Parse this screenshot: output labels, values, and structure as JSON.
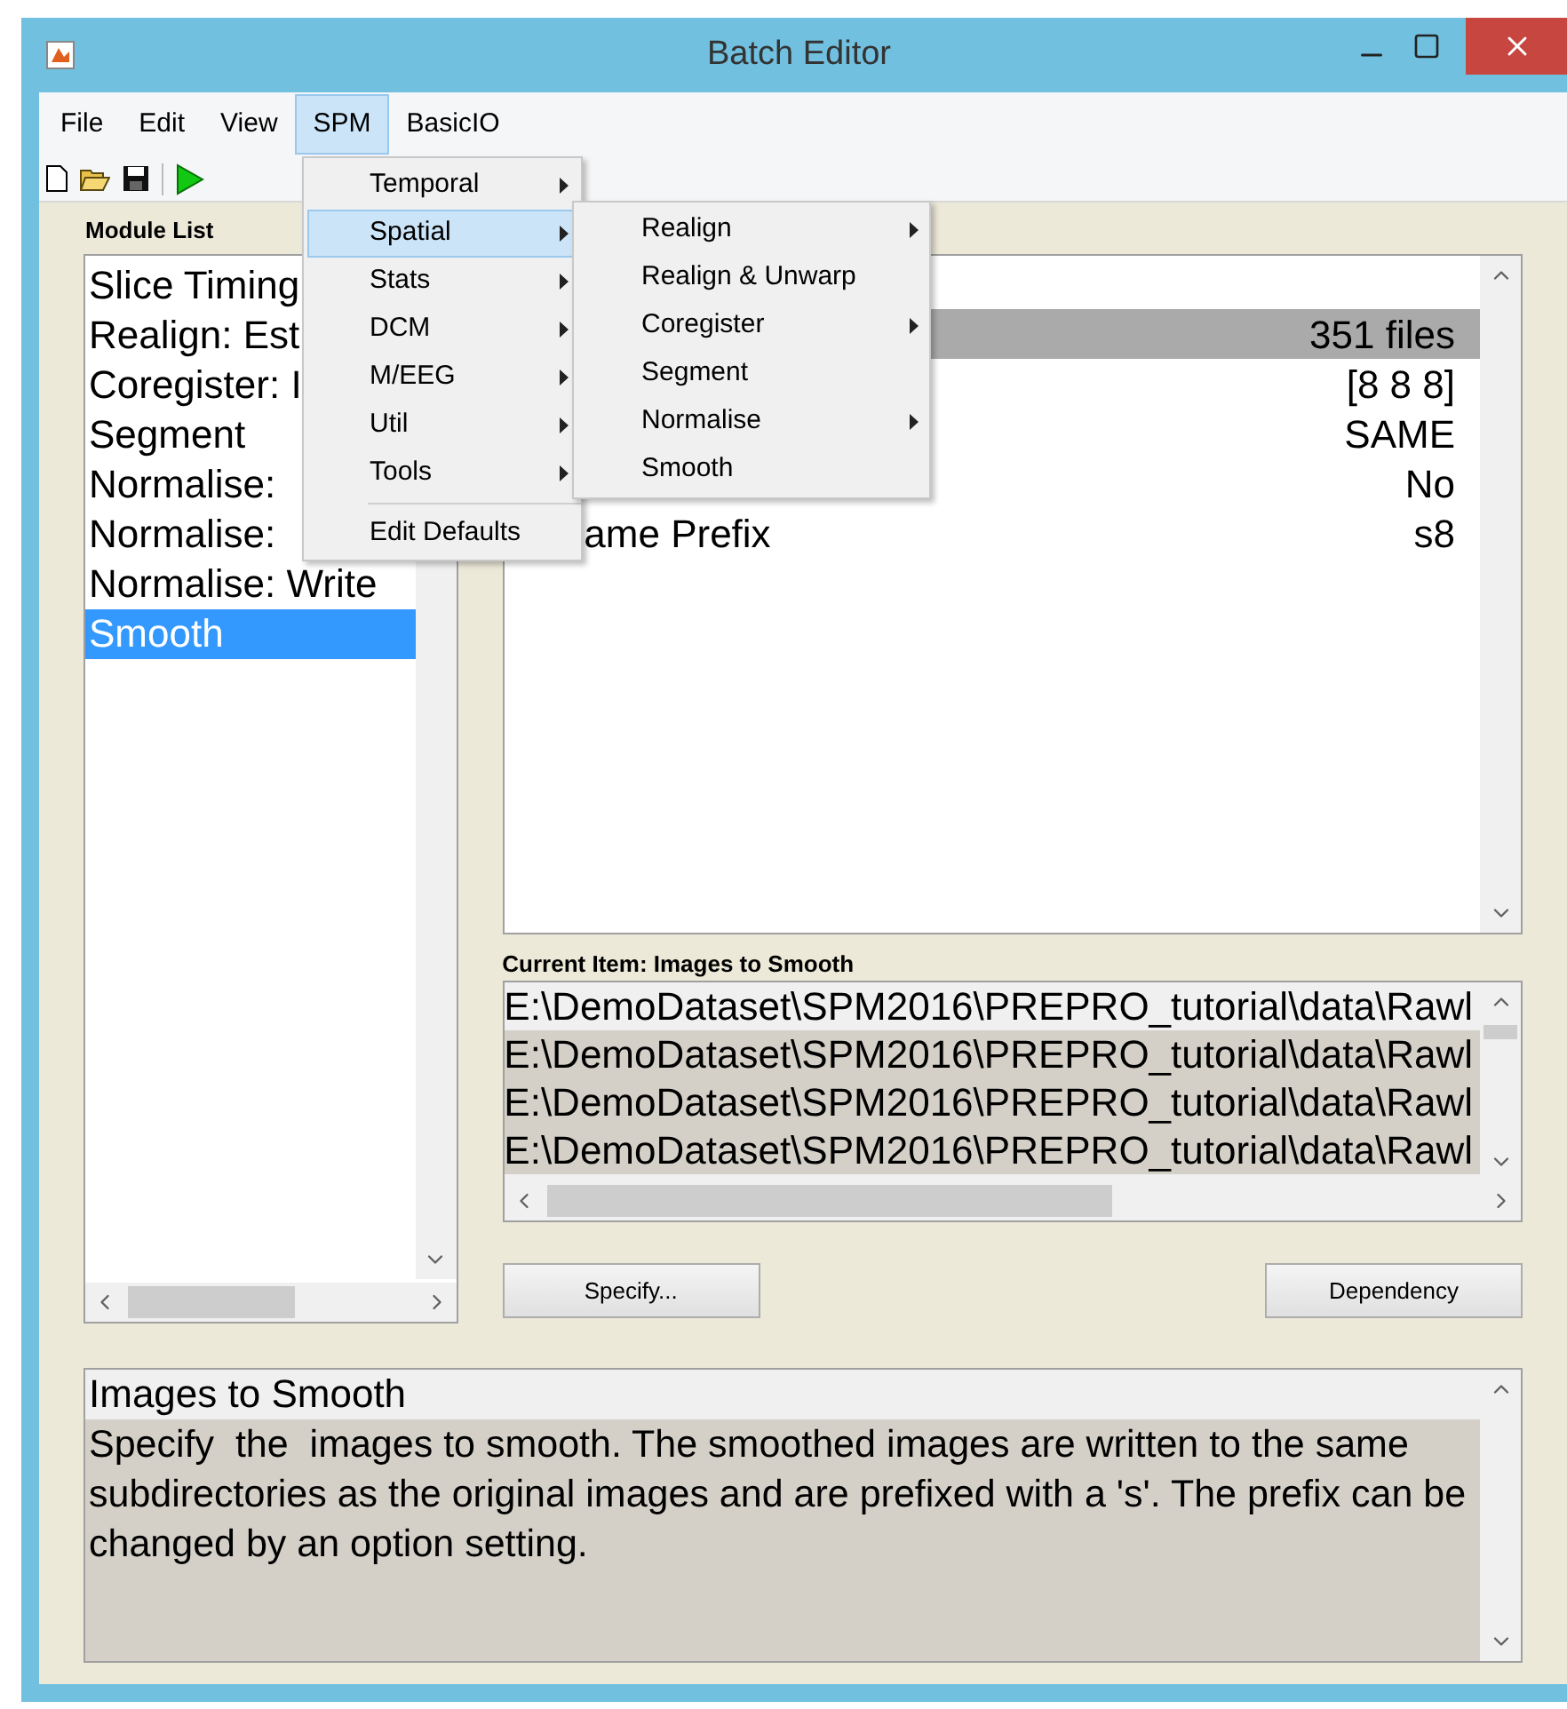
{
  "window": {
    "title": "Batch Editor"
  },
  "menu_bar": [
    {
      "label": "File",
      "selected": false
    },
    {
      "label": "Edit",
      "selected": false
    },
    {
      "label": "View",
      "selected": false
    },
    {
      "label": "SPM",
      "selected": true
    },
    {
      "label": "BasicIO",
      "selected": false
    }
  ],
  "spm_menu": {
    "items": [
      {
        "label": "Temporal",
        "submenu": true,
        "selected": false
      },
      {
        "label": "Spatial",
        "submenu": true,
        "selected": true
      },
      {
        "label": "Stats",
        "submenu": true,
        "selected": false
      },
      {
        "label": "DCM",
        "submenu": true,
        "selected": false
      },
      {
        "label": "M/EEG",
        "submenu": true,
        "selected": false
      },
      {
        "label": "Util",
        "submenu": true,
        "selected": false
      },
      {
        "label": "Tools",
        "submenu": true,
        "selected": false
      }
    ],
    "footer_item": "Edit Defaults"
  },
  "spatial_submenu": [
    {
      "label": "Realign",
      "submenu": true
    },
    {
      "label": "Realign & Unwarp",
      "submenu": false
    },
    {
      "label": "Coregister",
      "submenu": true
    },
    {
      "label": "Segment",
      "submenu": false
    },
    {
      "label": "Normalise",
      "submenu": true
    },
    {
      "label": "Smooth",
      "submenu": false
    }
  ],
  "module_list": {
    "title": "Module List",
    "items": [
      {
        "label": "Slice Timing",
        "selected": false
      },
      {
        "label": "Realign: Est",
        "selected": false
      },
      {
        "label": "Coregister: I",
        "selected": false
      },
      {
        "label": "Segment",
        "selected": false
      },
      {
        "label": "Normalise:",
        "selected": false
      },
      {
        "label": "Normalise:",
        "selected": false
      },
      {
        "label": "Normalise: Write",
        "selected": false
      },
      {
        "label": "Smooth",
        "selected": true
      }
    ]
  },
  "module_options": [
    {
      "value": "351 files",
      "selected": true
    },
    {
      "value": "[8 8 8]",
      "selected": false
    },
    {
      "value": "SAME",
      "selected": false
    },
    {
      "value": "No",
      "selected": false
    },
    {
      "label": "ame Prefix",
      "value": "s8",
      "selected": false
    }
  ],
  "current_item": {
    "title": "Current Item: Images to Smooth",
    "files": [
      {
        "path": "E:\\DemoDataset\\SPM2016\\PREPRO_tutorial\\data\\Rawl",
        "selected": false
      },
      {
        "path": "E:\\DemoDataset\\SPM2016\\PREPRO_tutorial\\data\\Rawl",
        "selected": true
      },
      {
        "path": "E:\\DemoDataset\\SPM2016\\PREPRO_tutorial\\data\\Rawl",
        "selected": true
      },
      {
        "path": "E:\\DemoDataset\\SPM2016\\PREPRO_tutorial\\data\\Rawl",
        "selected": true
      }
    ]
  },
  "buttons": [
    "Specify...",
    "Dependency"
  ],
  "help": {
    "title": "Images to Smooth",
    "text": "Specify  the  images to smooth. The smoothed images are written to the same subdirectories as the original images and are prefixed with a 's'. The prefix can be changed by an option setting."
  }
}
